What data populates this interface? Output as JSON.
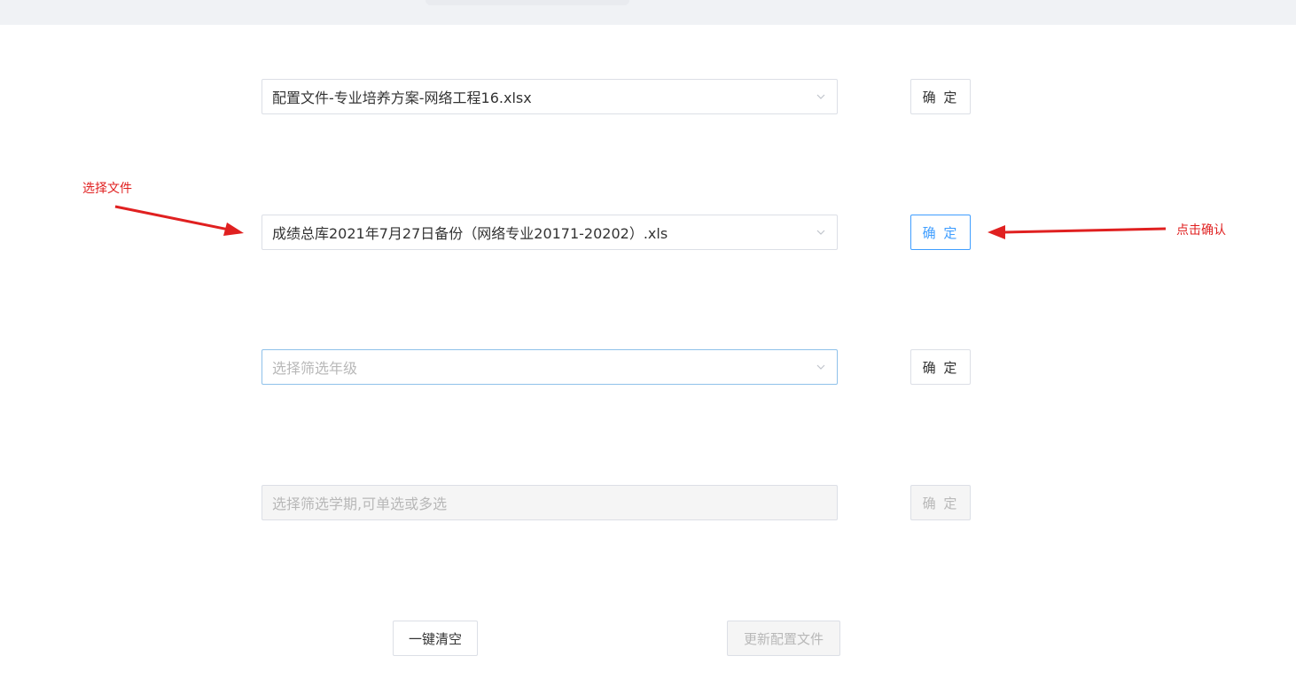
{
  "selects": [
    {
      "value": "配置文件-专业培养方案-网络工程16.xlsx",
      "placeholder": ""
    },
    {
      "value": "成绩总库2021年7月27日备份（网络专业20171-20202）.xls",
      "placeholder": ""
    },
    {
      "value": "",
      "placeholder": "选择筛选年级"
    },
    {
      "value": "",
      "placeholder": "选择筛选学期,可单选或多选"
    }
  ],
  "confirm_label": "确 定",
  "buttons": {
    "clear_all": "一键清空",
    "update_config": "更新配置文件"
  },
  "annotations": {
    "select_file": "选择文件",
    "click_confirm": "点击确认",
    "color": "#e02020"
  },
  "colors": {
    "primary": "#409eff",
    "border": "#dcdfe6",
    "disabled_bg": "#f5f5f5"
  },
  "icons": {
    "dropdown": "chevron-down-icon"
  }
}
